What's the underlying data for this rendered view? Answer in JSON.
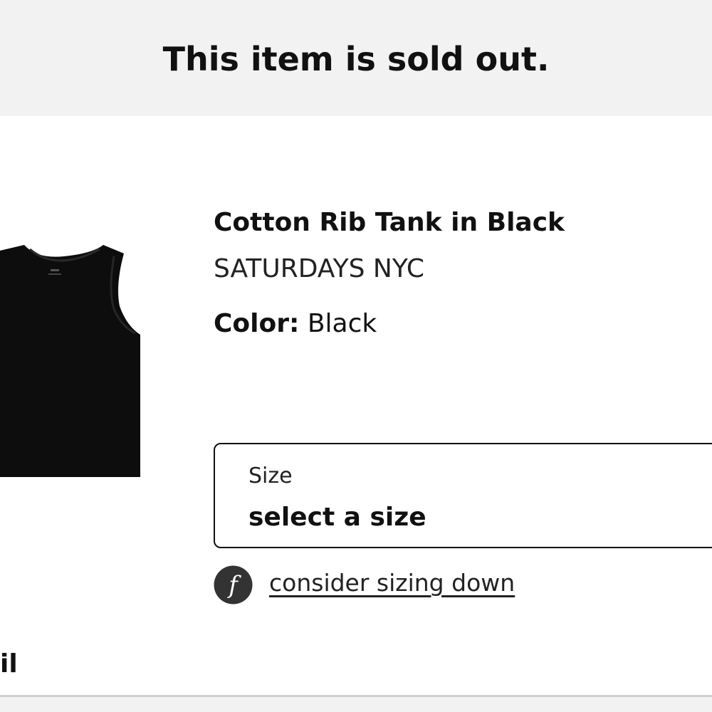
{
  "banner": {
    "text": "This item is sold out."
  },
  "product": {
    "title": "Cotton Rib Tank in Black",
    "brand": "SATURDAYS NYC",
    "color_label": "Color:",
    "color_value": "Black",
    "image_icon": "black-tank-top-image"
  },
  "size": {
    "label": "Size",
    "value": "select a size"
  },
  "fit_hint": {
    "icon": "fit-advisor-f-icon",
    "text": "consider sizing down"
  },
  "partial": {
    "text": "il"
  },
  "colors": {
    "banner_bg": "#f2f2f2",
    "text": "#111111",
    "product": "#0d0d0d"
  }
}
